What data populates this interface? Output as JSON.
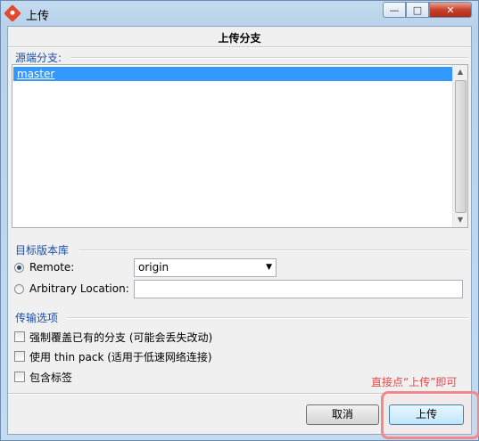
{
  "window": {
    "title": "上传",
    "controls": {
      "minimize": "—",
      "maximize": "□",
      "close": "✕"
    }
  },
  "dialog": {
    "heading": "上传分支",
    "source_branch": {
      "label": "源端分支:",
      "items": [
        "master"
      ],
      "selected": "master"
    },
    "target_repo": {
      "label": "目标版本库",
      "remote_label": "Remote:",
      "remote_value": "origin",
      "arbitrary_label": "Arbitrary Location:",
      "arbitrary_value": "",
      "selected": "Remote:"
    },
    "transfer_options": {
      "label": "传输选项",
      "options": [
        {
          "label": "强制覆盖已有的分支 (可能会丢失改动)",
          "checked": false
        },
        {
          "label": "使用 thin pack (适用于低速网络连接)",
          "checked": false
        },
        {
          "label": "包含标签",
          "checked": false
        }
      ]
    },
    "annotation": "直接点“上传”即可",
    "buttons": {
      "cancel": "取消",
      "upload": "上传"
    }
  },
  "icons": {
    "app": "git-diamond-icon",
    "dropdown": "chevron-down-icon",
    "scroll_up": "scroll-up-arrow-icon",
    "scroll_down": "scroll-down-arrow-icon"
  },
  "colors": {
    "accent": "#3399ff",
    "group_label": "#1b4fa8",
    "annotation": "#e24b4b",
    "highlight": "#f08a8a"
  }
}
